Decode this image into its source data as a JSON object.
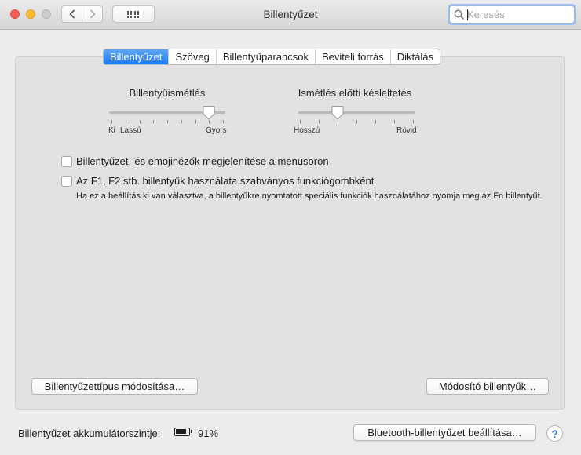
{
  "window": {
    "title": "Billentyűzet"
  },
  "toolbar": {
    "back_icon": "chevron-left-icon",
    "forward_icon": "chevron-right-icon",
    "grid_icon": "grid-icon",
    "search_placeholder": "Keresés"
  },
  "tabs": [
    {
      "label": "Billentyűzet",
      "active": true
    },
    {
      "label": "Szöveg",
      "active": false
    },
    {
      "label": "Billentyűparancsok",
      "active": false
    },
    {
      "label": "Beviteli forrás",
      "active": false
    },
    {
      "label": "Diktálás",
      "active": false
    }
  ],
  "key_repeat": {
    "label": "Billentyűismétlés",
    "min_label": "Ki",
    "slow_label": "Lassú",
    "max_label": "Gyors",
    "value_step": 7,
    "steps": 8
  },
  "delay_until_repeat": {
    "label": "Ismétlés előtti késleltetés",
    "min_label": "Hosszú",
    "max_label": "Rövid",
    "value_step": 2,
    "steps": 6
  },
  "checkboxes": [
    {
      "label": "Billentyűzet- és emojinézők megjelenítése a menüsoron",
      "checked": false
    },
    {
      "label": "Az F1, F2 stb. billentyűk használata szabványos funkciógombként",
      "checked": false
    }
  ],
  "fn_description": "Ha ez a beállítás ki van választva, a billentyűkre nyomtatott speciális funkciók használatához nyomja meg az Fn billentyűt.",
  "buttons": {
    "change_keyboard_type": "Billentyűzettípus módosítása…",
    "modifier_keys": "Módosító billentyűk…",
    "bluetooth_setup": "Bluetooth-billentyűzet beállítása…",
    "help": "?"
  },
  "battery": {
    "label": "Billentyűzet akkumulátorszintje:",
    "percent_text": "91%",
    "level": 0.91
  },
  "colors": {
    "accent": "#1a7af2",
    "close": "#fc5f57",
    "minimize": "#fdbc2e"
  }
}
